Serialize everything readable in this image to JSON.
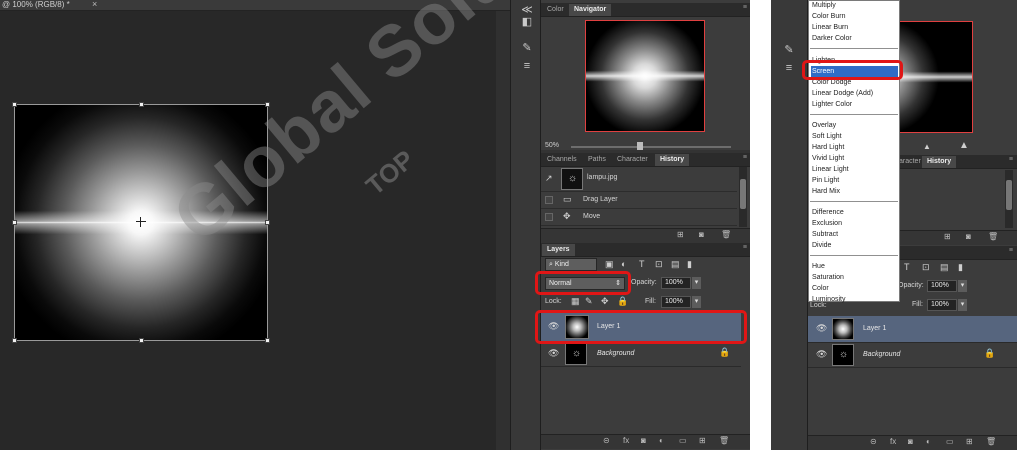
{
  "document": {
    "tab_title": "@ 100% (RGB/8) *",
    "tab_close": "×"
  },
  "panels_left": {
    "nav_tabs": [
      "Color",
      "Navigator"
    ],
    "zoom": "50%",
    "history_tabs": [
      "Channels",
      "Paths",
      "Character",
      "History"
    ],
    "history_items": [
      {
        "label": "lampu.jpg"
      },
      {
        "label": "Drag Layer"
      },
      {
        "label": "Move"
      }
    ],
    "layers_tab": "Layers",
    "kind_label": "Kind",
    "blend_mode": "Normal",
    "opacity_label": "Opacity:",
    "opacity_value": "100%",
    "lock_label": "Lock:",
    "fill_label": "Fill:",
    "fill_value": "100%",
    "layers": [
      {
        "name": "Layer 1",
        "selected": true
      },
      {
        "name": "Background",
        "selected": false
      }
    ]
  },
  "panels_right": {
    "history_tabs": [
      "aracter",
      "History"
    ],
    "opacity_label": "Opacity:",
    "opacity_value": "100%",
    "fill_label": "Fill:",
    "fill_value": "100%",
    "lock_label": "Lock:",
    "layers": [
      {
        "name": "Layer 1"
      },
      {
        "name": "Background"
      }
    ],
    "blend_menu": {
      "group1": [
        "Multiply",
        "Color Burn",
        "Linear Burn",
        "Darker Color"
      ],
      "group2": [
        "Lighten",
        "Screen",
        "Color Dodge",
        "Linear Dodge (Add)",
        "Lighter Color"
      ],
      "group3": [
        "Overlay",
        "Soft Light",
        "Hard Light",
        "Vivid Light",
        "Linear Light",
        "Pin Light",
        "Hard Mix"
      ],
      "group4": [
        "Difference",
        "Exclusion",
        "Subtract",
        "Divide"
      ],
      "group5": [
        "Hue",
        "Saturation",
        "Color",
        "Luminosity"
      ],
      "selected": "Screen"
    }
  },
  "watermark": {
    "main": "Global Solutions",
    "small": "TOP"
  },
  "colors": {
    "highlight_red": "#e01616",
    "menu_selected": "#2f6cc6",
    "layer_selected": "#56657e"
  }
}
